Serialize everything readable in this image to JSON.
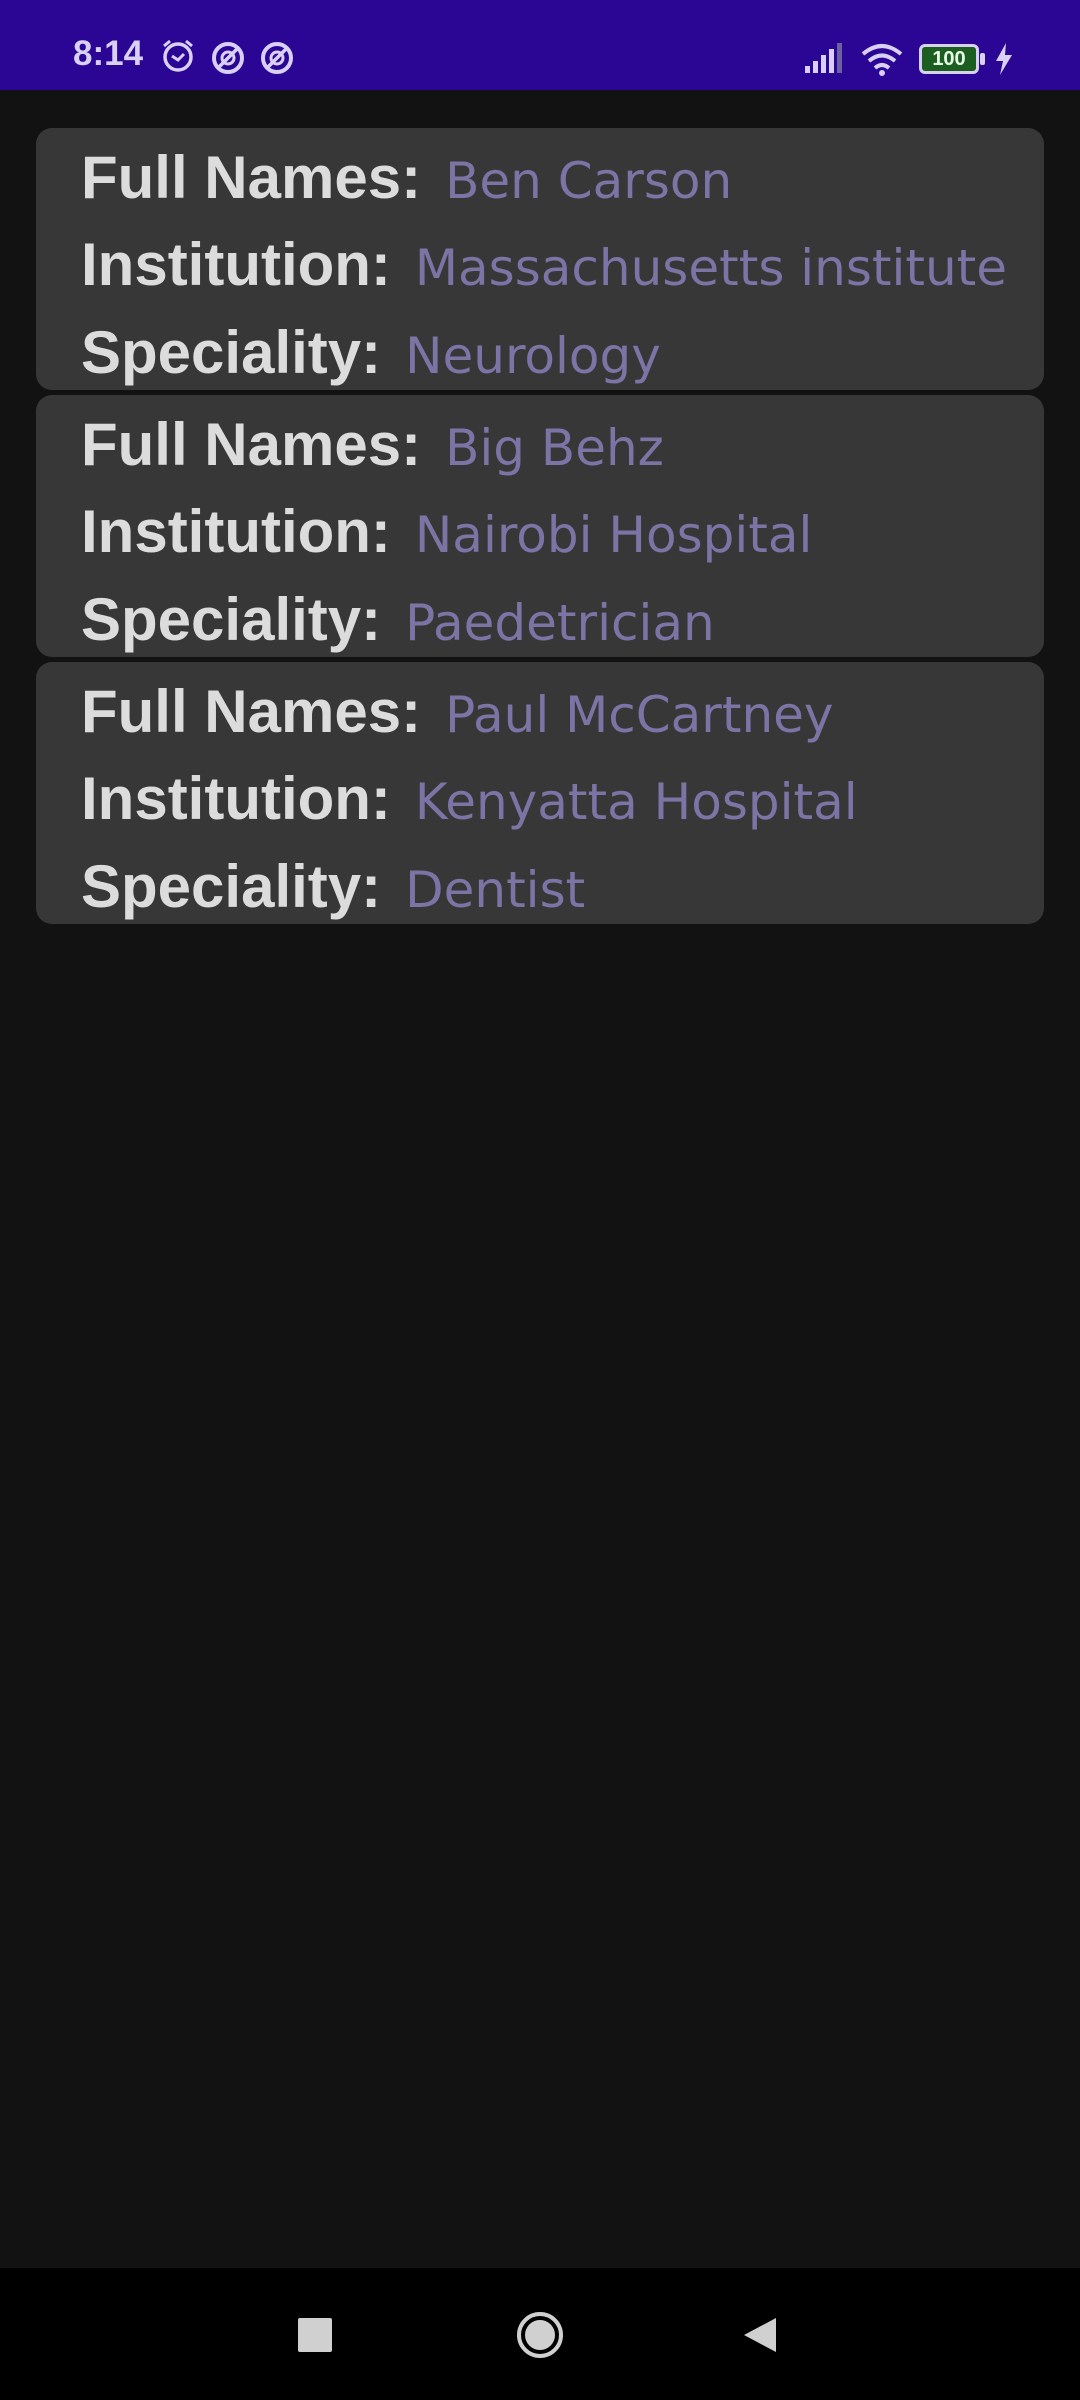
{
  "status_bar": {
    "time": "8:14",
    "battery_level": "100",
    "accent_color": "#2b0593"
  },
  "doctors": [
    {
      "full_names_label": "Full Names:",
      "full_names": "Ben Carson",
      "institution_label": "Institution:",
      "institution": "Massachusetts institute",
      "speciality_label": "Speciality:",
      "speciality": "Neurology"
    },
    {
      "full_names_label": "Full Names:",
      "full_names": "Big Behz",
      "institution_label": "Institution:",
      "institution": "Nairobi Hospital",
      "speciality_label": "Speciality:",
      "speciality": "Paedetrician"
    },
    {
      "full_names_label": "Full Names:",
      "full_names": "Paul McCartney",
      "institution_label": "Institution:",
      "institution": "Kenyatta Hospital",
      "speciality_label": "Speciality:",
      "speciality": "Dentist"
    }
  ],
  "nav_bar": {
    "icons": [
      "recents-square-icon",
      "home-circle-icon",
      "back-triangle-icon"
    ]
  }
}
